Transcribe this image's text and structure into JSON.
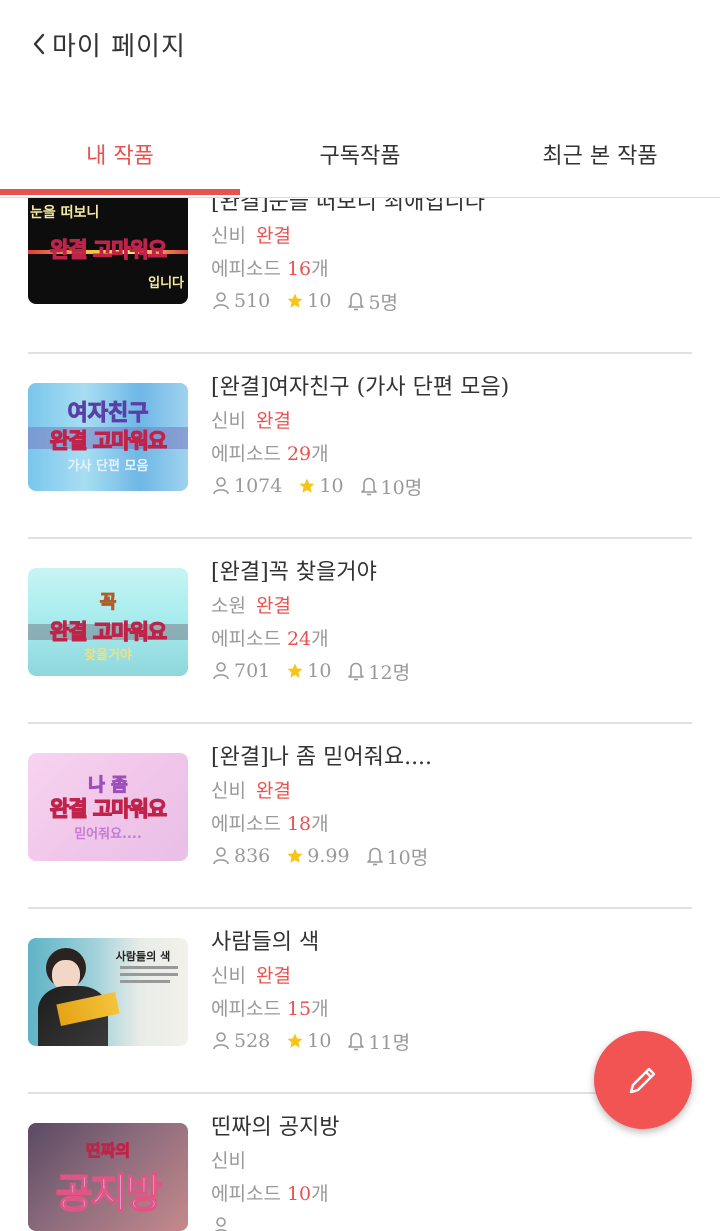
{
  "header": {
    "title": "마이 페이지",
    "back_icon": "chevron-left-icon"
  },
  "tabs": [
    {
      "label": "내 작품",
      "active": true
    },
    {
      "label": "구독작품",
      "active": false
    },
    {
      "label": "최근 본 작품",
      "active": false
    }
  ],
  "accent_color": "#e8524f",
  "episode_prefix": "에피소드 ",
  "episode_suffix": "개",
  "works": [
    {
      "title": "[완결]눈을 떠보니 최애입니다",
      "genre": "신비",
      "status": "완결",
      "episodes": "16",
      "views": "510",
      "rating": "10",
      "subscribers": "5명",
      "thumb_text": {
        "top": "눈을 떠보니",
        "main": "완결 고마워요",
        "bottom": "입니다"
      }
    },
    {
      "title": "[완결]여자친구 (가사 단편 모음)",
      "genre": "신비",
      "status": "완결",
      "episodes": "29",
      "views": "1074",
      "rating": "10",
      "subscribers": "10명",
      "thumb_text": {
        "top": "여자친구",
        "main": "완결 고마워요",
        "bottom": "가사 단편 모음"
      }
    },
    {
      "title": "[완결]꼭 찾을거야",
      "genre": "소원",
      "status": "완결",
      "episodes": "24",
      "views": "701",
      "rating": "10",
      "subscribers": "12명",
      "thumb_text": {
        "top": "꼭",
        "main": "완결 고마워요",
        "bottom": "찾을거야"
      }
    },
    {
      "title": "[완결]나 좀 믿어줘요....",
      "genre": "신비",
      "status": "완결",
      "episodes": "18",
      "views": "836",
      "rating": "9.99",
      "subscribers": "10명",
      "thumb_text": {
        "top": "나 좀",
        "main": "완결 고마워요",
        "bottom": "믿어줘요...."
      }
    },
    {
      "title": "사람들의 색",
      "genre": "신비",
      "status": "완결",
      "episodes": "15",
      "views": "528",
      "rating": "10",
      "subscribers": "11명",
      "thumb_text": {
        "top": "사람들의 색",
        "main": "",
        "bottom": ""
      }
    },
    {
      "title": "띤짜의 공지방",
      "genre": "신비",
      "status": "",
      "episodes": "10",
      "views": "",
      "rating": "",
      "subscribers": "",
      "thumb_text": {
        "top": "띤짜의",
        "main": "공지방",
        "bottom": ""
      }
    }
  ],
  "fab": {
    "icon": "pencil-icon",
    "color": "#f25454"
  }
}
